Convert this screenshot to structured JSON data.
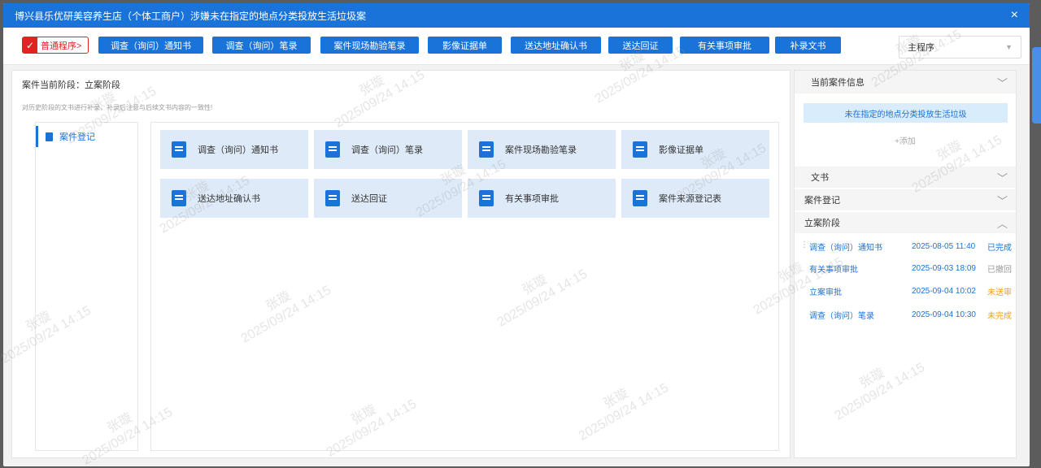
{
  "dialog": {
    "title": "博兴县乐优研美容养生店（个体工商户）涉嫌未在指定的地点分类投放生活垃圾案",
    "close_icon": "×"
  },
  "toolbar": {
    "mode_label": "普通程序>",
    "mode_check": "✓",
    "buttons": [
      "调查（询问）通知书",
      "调查（询问）笔录",
      "案件现场勘验笔录",
      "影像证据单",
      "送达地址确认书",
      "送达回证",
      "有关事项审批",
      "补录文书"
    ],
    "select_value": "主程序",
    "select_caret": "▼"
  },
  "main": {
    "stage_title": "案件当前阶段：立案阶段",
    "stage_hint": "对历史阶段的文书进行补录，补录后注意与后续文书内容的一致性!",
    "nav_item": "案件登记",
    "cards": [
      "调查（询问）通知书",
      "调查（询问）笔录",
      "案件现场勘验笔录",
      "影像证据单",
      "送达地址确认书",
      "送达回证",
      "有关事项审批",
      "案件来源登记表"
    ]
  },
  "right": {
    "header": "当前案件信息",
    "case_tag": "未在指定的地点分类投放生活垃圾",
    "add_label": "+添加",
    "sections": [
      "文书",
      "案件登记",
      "立案阶段"
    ],
    "chevron_down": "﹀",
    "chevron_up": "︿",
    "documents": [
      {
        "name": "调查（询问）通知书",
        "date": "2025-08-05 11:40",
        "status": "已完成",
        "color": "#1a73d9"
      },
      {
        "name": "有关事项审批",
        "date": "2025-09-03 18:09",
        "status": "已撤回",
        "color": "#999999"
      },
      {
        "name": "立案审批",
        "date": "2025-09-04 10:02",
        "status": "未送审",
        "color": "#f0a020"
      },
      {
        "name": "调查（询问）笔录",
        "date": "2025-09-04 10:30",
        "status": "未完成",
        "color": "#f0a020"
      }
    ],
    "dots": "⋮"
  },
  "watermark": {
    "name": "张璇",
    "time": "2025/09/24 14:15"
  },
  "colors": {
    "primary": "#1a73d9",
    "danger": "#e02424",
    "warning": "#f0a020"
  }
}
